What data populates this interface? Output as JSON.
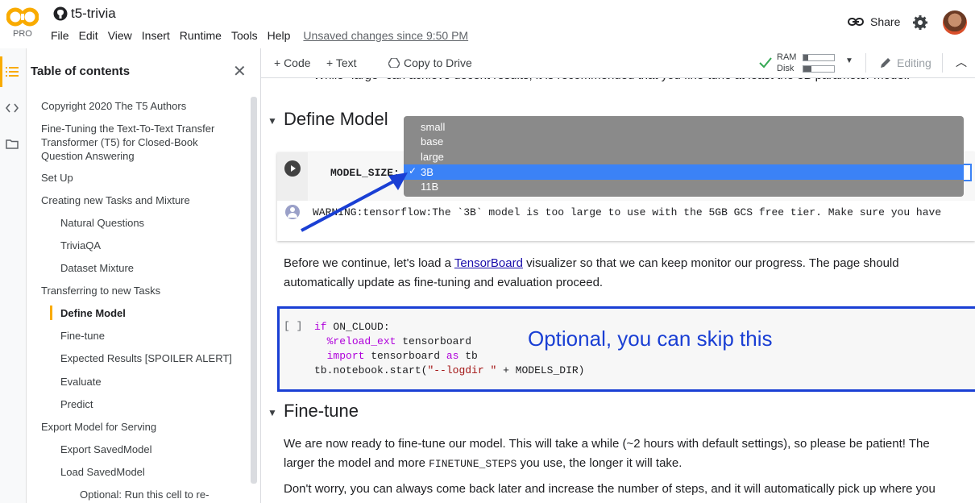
{
  "app": {
    "pro_label": "PRO",
    "notebook_title": "t5-trivia",
    "menu": [
      "File",
      "Edit",
      "View",
      "Insert",
      "Runtime",
      "Tools",
      "Help"
    ],
    "unsaved_notice": "Unsaved changes since 9:50 PM",
    "share_label": "Share"
  },
  "toolbar": {
    "add_code": "+ Code",
    "add_text": "+ Text",
    "copy_to_drive": "Copy to Drive",
    "ram_label": "RAM",
    "disk_label": "Disk",
    "editing_label": "Editing"
  },
  "toc": {
    "title": "Table of contents",
    "items": [
      {
        "label": "Copyright 2020 The T5 Authors",
        "level": 1
      },
      {
        "label": "Fine-Tuning the Text-To-Text Transfer Transformer (T5) for Closed-Book Question Answering",
        "level": 1
      },
      {
        "label": "Set Up",
        "level": 1
      },
      {
        "label": "Creating new Tasks and Mixture",
        "level": 1
      },
      {
        "label": "Natural Questions",
        "level": 2
      },
      {
        "label": "TriviaQA",
        "level": 2
      },
      {
        "label": "Dataset Mixture",
        "level": 2
      },
      {
        "label": "Transferring to new Tasks",
        "level": 1
      },
      {
        "label": "Define Model",
        "level": 2,
        "active": true
      },
      {
        "label": "Fine-tune",
        "level": 2
      },
      {
        "label": "Expected Results [SPOILER ALERT]",
        "level": 2
      },
      {
        "label": "Evaluate",
        "level": 2
      },
      {
        "label": "Predict",
        "level": 2
      },
      {
        "label": "Export Model for Serving",
        "level": 1
      },
      {
        "label": "Export SavedModel",
        "level": 2
      },
      {
        "label": "Load SavedModel",
        "level": 2
      },
      {
        "label": "Optional: Run this cell to re-",
        "level": 3
      }
    ]
  },
  "main": {
    "top_cut_text": "While \"large\" can achieve decent results, it is recommended that you fine-tune at least the 3B parameter model.",
    "define_model_heading": "Define Model",
    "model_size_label": "MODEL_SIZE:",
    "model_size_options": [
      "small",
      "base",
      "large",
      "3B",
      "11B"
    ],
    "model_size_selected": "3B",
    "warning_text": "WARNING:tensorflow:The `3B` model is too large to use with the 5GB GCS free tier. Make sure you have",
    "para1_before_link": "Before we continue, let's load a ",
    "para1_link": "TensorBoard",
    "para1_after_link": " visualizer so that we can keep monitor our progress. The page should",
    "para1_line2": "automatically update as fine-tuning and evaluation proceed.",
    "code_prompt": "[ ]",
    "code_line1_kw": "if",
    "code_line1_rest": " ON_CLOUD:",
    "code_line2_magic": "%reload_ext",
    "code_line2_rest": " tensorboard",
    "code_line3_kw": "import",
    "code_line3_mid": " tensorboard ",
    "code_line3_as": "as",
    "code_line3_rest": " tb",
    "code_line4_a": "tb.notebook.start(",
    "code_line4_str": "\"--logdir \"",
    "code_line4_b": " + MODELS_DIR)",
    "annotation": "Optional, you can skip this",
    "finetune_heading": "Fine-tune",
    "para2_line1": "We are now ready to fine-tune our model. This will take a while (~2 hours with default settings), so please be patient! The",
    "para2_line2_a": "larger the model and more ",
    "para2_line2_code": "FINETUNE_STEPS",
    "para2_line2_b": " you use, the longer it will take.",
    "para3_line1": "Don't worry, you can always come back later and increase the number of steps, and it will automatically pick up where you"
  },
  "colors": {
    "accent_orange": "#f9ab00",
    "annotation_blue": "#1a3fd4",
    "selection_blue": "#3b82f6",
    "keyword": "#af00db",
    "magic": "#795e26",
    "string": "#a31515"
  }
}
